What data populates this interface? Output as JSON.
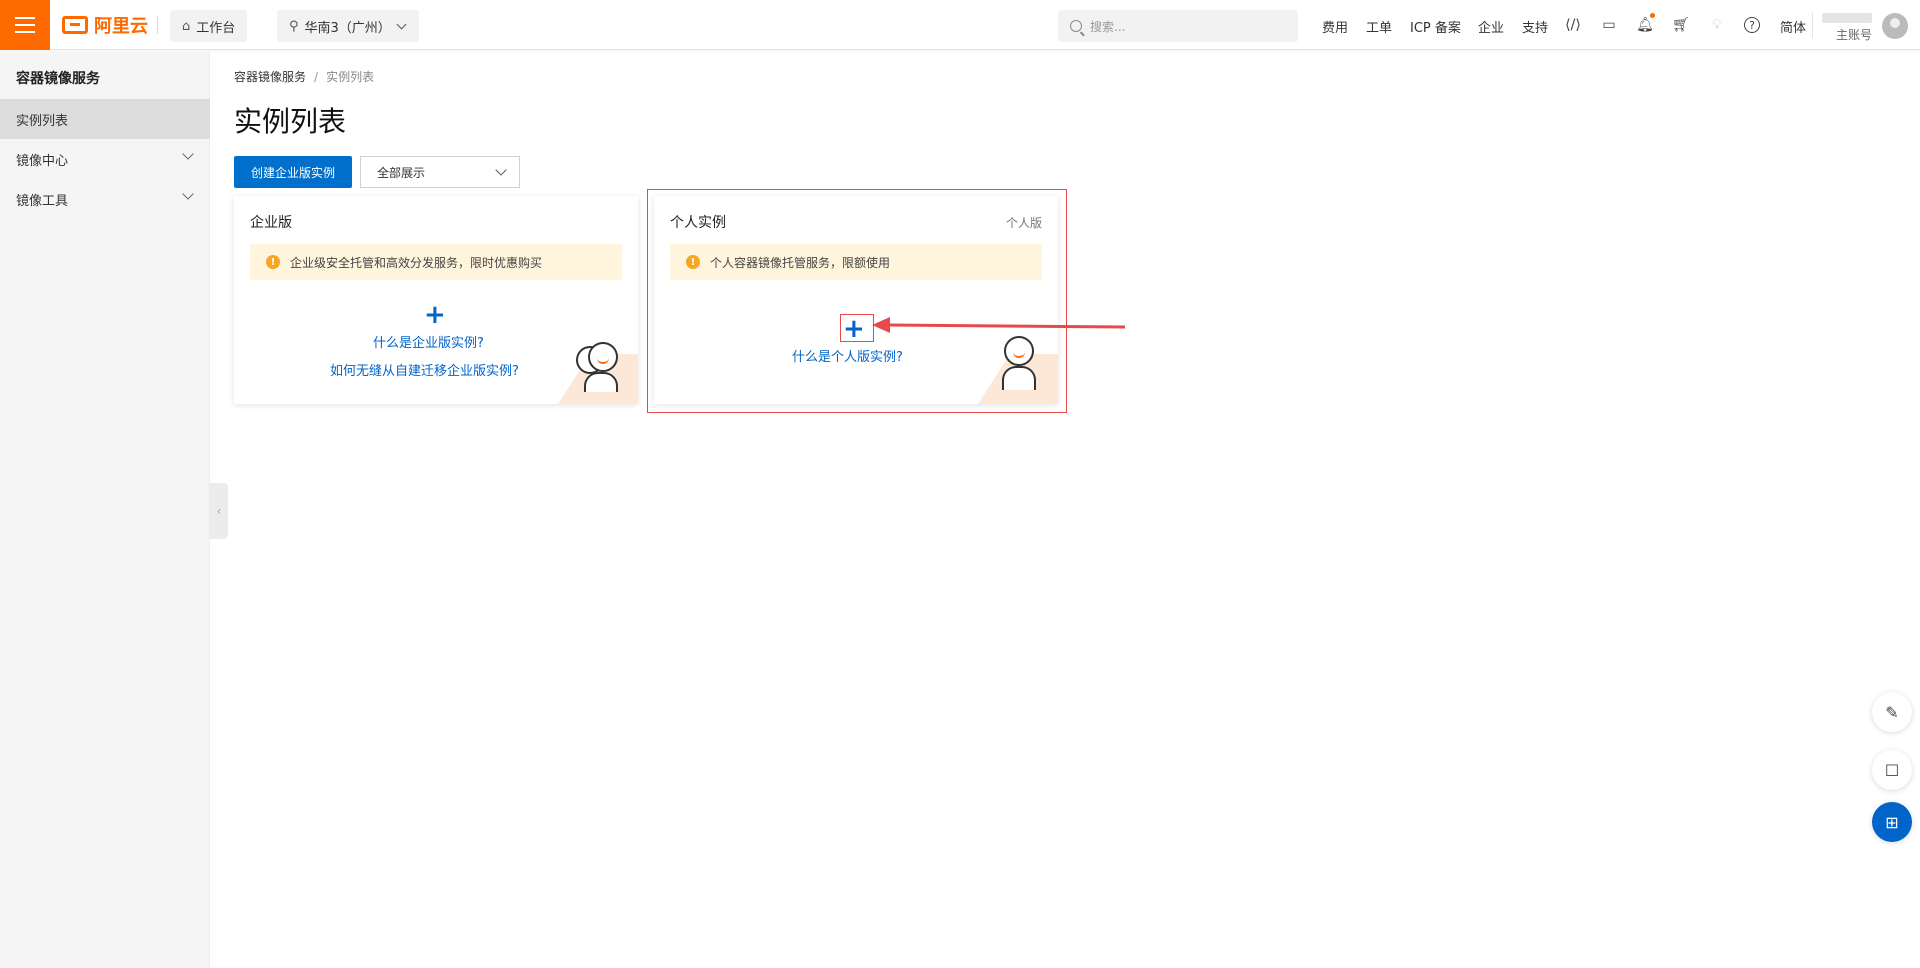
{
  "header": {
    "logo_text": "阿里云",
    "workbench_label": "工作台",
    "region_label": "华南3（广州）",
    "search_placeholder": "搜索...",
    "nav": [
      "费用",
      "工单",
      "ICP 备案",
      "企业",
      "支持"
    ],
    "language": "简体",
    "account_label": "主账号"
  },
  "sidebar": {
    "title": "容器镜像服务",
    "items": [
      {
        "label": "实例列表"
      },
      {
        "label": "镜像中心"
      },
      {
        "label": "镜像工具"
      }
    ]
  },
  "breadcrumb": {
    "root": "容器镜像服务",
    "sep": "/",
    "current": "实例列表"
  },
  "page": {
    "title": "实例列表",
    "create_button": "创建企业版实例",
    "filter_value": "全部展示"
  },
  "cards": {
    "enterprise": {
      "title": "企业版",
      "notice": "企业级安全托管和高效分发服务，限时优惠购买",
      "plus": "+",
      "link1": "什么是企业版实例?",
      "link2": "如何无缝从自建迁移企业版实例?"
    },
    "personal": {
      "title": "个人实例",
      "tag": "个人版",
      "notice": "个人容器镜像托管服务，限额使用",
      "plus": "+",
      "link1": "什么是个人版实例?"
    }
  },
  "colors": {
    "brand": "#ff6a00",
    "primary": "#0070cc",
    "link": "#0064c8",
    "annotation": "#e84a4a",
    "notice_bg": "#fff5dc"
  }
}
